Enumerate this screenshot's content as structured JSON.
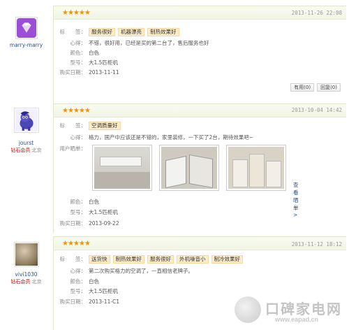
{
  "labels": {
    "tags": "标　　签：",
    "comment": "心得：",
    "color": "颜色：",
    "model": "型号：",
    "buy_date": "购买日期：",
    "user_photos": "用户晒单："
  },
  "reviews": [
    {
      "user": {
        "name": "marry-marry",
        "level": "",
        "location": ""
      },
      "rating": 5,
      "stars": "★★★★★",
      "date": "2013-11-26 22:08",
      "tags": [
        "服务很好",
        "机器漂亮",
        "制热效果好"
      ],
      "comment": "不错，很好用，已经是买的第二台了，售后服务也好",
      "color": "白色",
      "model": "大1.5匹柜机",
      "buy_date": "2013-11-11",
      "useful": "有用(0)",
      "reply": "回复(0)"
    },
    {
      "user": {
        "name": "jourst",
        "level": "钻石会员",
        "location": "北京"
      },
      "rating": 5,
      "stars": "★★★★★",
      "date": "2013-10-04 14:42",
      "tags": [
        "空调质量好"
      ],
      "comment": "格力，国产中应该还是不错的，家里装修，一下买了2台，期待效果吧~",
      "color": "白色",
      "model": "大1.5匹柜机",
      "buy_date": "2013-09-22",
      "more_photos": "查看晒单>"
    },
    {
      "user": {
        "name": "vivi1030",
        "level": "钻石会员",
        "location": "北京"
      },
      "rating": 5,
      "stars": "★★★★★",
      "date": "2013-11-12 18:12",
      "tags": [
        "送货快",
        "制热效果好",
        "服务很好",
        "外机噪音小",
        "制冷效果好"
      ],
      "comment": "第二次购买格力的空调了，一直相信老牌子。",
      "color": "白色",
      "model": "大1.5匹柜机",
      "buy_date": "2013-11-C1"
    }
  ],
  "watermark": {
    "title": "口碑家电网",
    "url": "www.eapad.cn"
  },
  "colors": {
    "star": "#f39200",
    "tag_bg": "#fdecc8",
    "level": "#d40000",
    "link": "#2d4f89"
  }
}
